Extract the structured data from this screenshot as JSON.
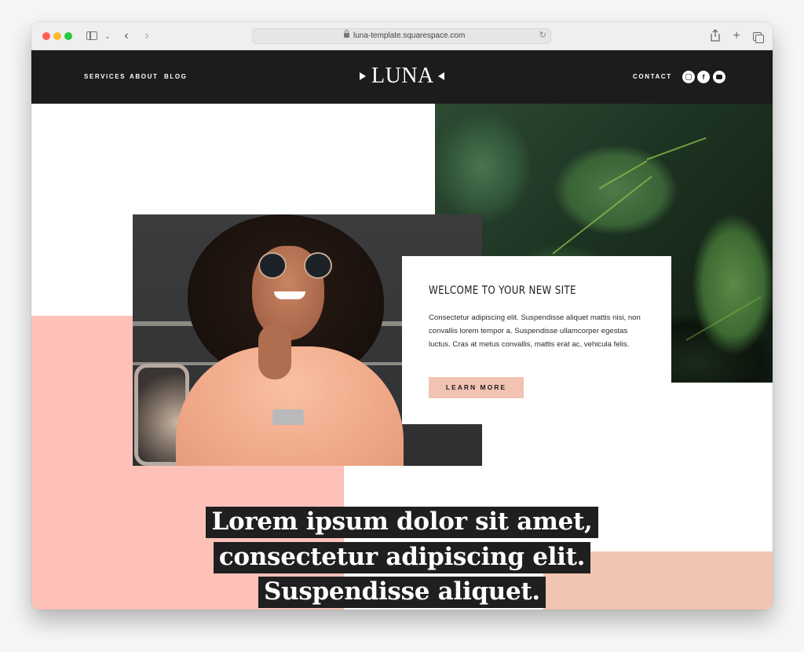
{
  "browser": {
    "url": "luna-template.squarespace.com",
    "toolbar_icons": [
      "sidebar-icon",
      "chevron-down-icon",
      "back-arrow-icon",
      "forward-arrow-icon",
      "lock-icon",
      "reload-icon",
      "share-icon",
      "new-tab-plus-icon",
      "tab-overview-icon"
    ]
  },
  "header": {
    "nav_left": [
      {
        "label": "SERVICES"
      },
      {
        "label": "ABOUT"
      },
      {
        "label": "BLOG"
      }
    ],
    "logo": "LUNA",
    "nav_right": [
      {
        "label": "CONTACT"
      }
    ],
    "social": [
      {
        "name": "instagram-icon",
        "glyph": ""
      },
      {
        "name": "facebook-icon",
        "glyph": "f"
      },
      {
        "name": "youtube-icon",
        "glyph": ""
      }
    ]
  },
  "welcome": {
    "title": "WELCOME TO YOUR NEW SITE",
    "body": "Consectetur adipiscing elit. Suspendisse aliquet mattis nisi, non convallis lorem tempor a. Suspendisse ullamcorper egestas luctus. Cras at metus convallis, mattis erat ac, vehicula felis.",
    "button": "LEARN MORE"
  },
  "headline": {
    "lines": [
      "Lorem ipsum dolor sit amet,",
      "consectetur adipiscing elit.",
      "Suspendisse aliquet."
    ]
  },
  "colors": {
    "header_bg": "#1c1c1c",
    "pink": "#fdc1b8",
    "salmon": "#f2c4b2",
    "button_bg": "#f2c2b2",
    "headline_bg": "#1f1f1f"
  }
}
